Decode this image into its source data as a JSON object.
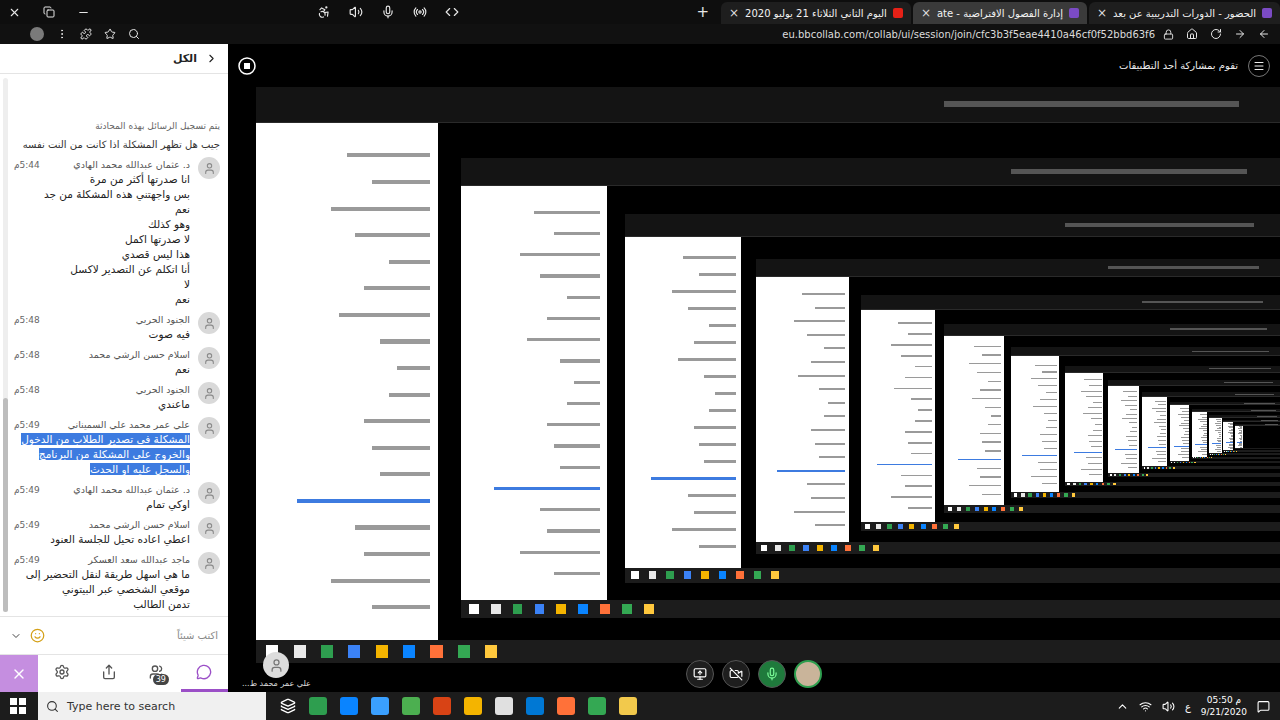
{
  "browser": {
    "tabs": [
      {
        "label": "اليوم الثاني الثلاثاء 21 يوليو 2020",
        "selected": false,
        "color": "#e62117"
      },
      {
        "label": "إدارة الفصول الافتراضية - ate",
        "selected": true,
        "color": "#7b4bc4"
      },
      {
        "label": "الحضور - الدورات التدريبية عن بعد",
        "selected": false,
        "color": "#7b4bc4"
      }
    ],
    "tab_close": "×",
    "new_tab": "+",
    "url": "eu.bbcollab.com/collab/ui/session/join/cfc3b3f5eae4410a46cf0f52bbd63f6"
  },
  "chat": {
    "header": "الكل",
    "notice": "يتم تسجيل الرسائل بهذه المحادثة",
    "partial_message": "جيب هل تظهر المشكلة اذا كانت من النت نفسه",
    "messages": [
      {
        "author": "د. عثمان عبدالله محمد الهادي",
        "time": "5:44م",
        "lines": [
          "انا صدرتها أكثر من مرة",
          "بس واجهتني هذه المشكلة من جد",
          "نعم",
          "وهو كذلك",
          "لا صدرتها اكمل",
          "هذا ليس قصدي",
          "أنا اتكلم عن التصدير لاكسل",
          "لا",
          "نعم"
        ],
        "highlighted": false
      },
      {
        "author": "الجنود الحربي",
        "time": "5:48م",
        "lines": [
          "فيه صوت"
        ],
        "highlighted": false
      },
      {
        "author": "اسلام حسن الرشي محمد",
        "time": "5:48م",
        "lines": [
          "نعم"
        ],
        "highlighted": false
      },
      {
        "author": "الجنود الحربي",
        "time": "5:48م",
        "lines": [
          "ماعندي"
        ],
        "highlighted": false
      },
      {
        "author": "علي عمر محمد علي السميناني",
        "time": "5:49م",
        "lines": [
          "المشكلة في تصدير الطلاب من الدخول والخروج على المشكلة من البرنامج والسجل عليه او الحدث"
        ],
        "highlighted": true
      },
      {
        "author": "د. عثمان عبدالله محمد الهادي",
        "time": "5:49م",
        "lines": [
          "اوكي تمام"
        ],
        "highlighted": false
      },
      {
        "author": "اسلام حسن الرشي محمد",
        "time": "5:49م",
        "lines": [
          "اعطي اعاده تحيل للجلسة العنود"
        ],
        "highlighted": false
      },
      {
        "author": "ماجد عبدالله سعد العسكر",
        "time": "5:49م",
        "lines": [
          "ما هي اسهل طريقة لنقل التحضير إلى موقعي الشخصي عبر البيتوني",
          "تدمن الطالب"
        ],
        "highlighted": false
      }
    ],
    "input_placeholder": "اكتب شيئاً",
    "participant_count": "39",
    "chat_tab_selected": true
  },
  "share": {
    "banner": "تقوم بمشاركة أحد التطبيقات"
  },
  "session": {
    "presenter": "علي عمر محمد ط...",
    "mic_on": true,
    "camera_on": false
  },
  "taskbar": {
    "search": "Type here to search",
    "lang": "ع",
    "time": "05:50 م",
    "date": "9/21/2020"
  }
}
